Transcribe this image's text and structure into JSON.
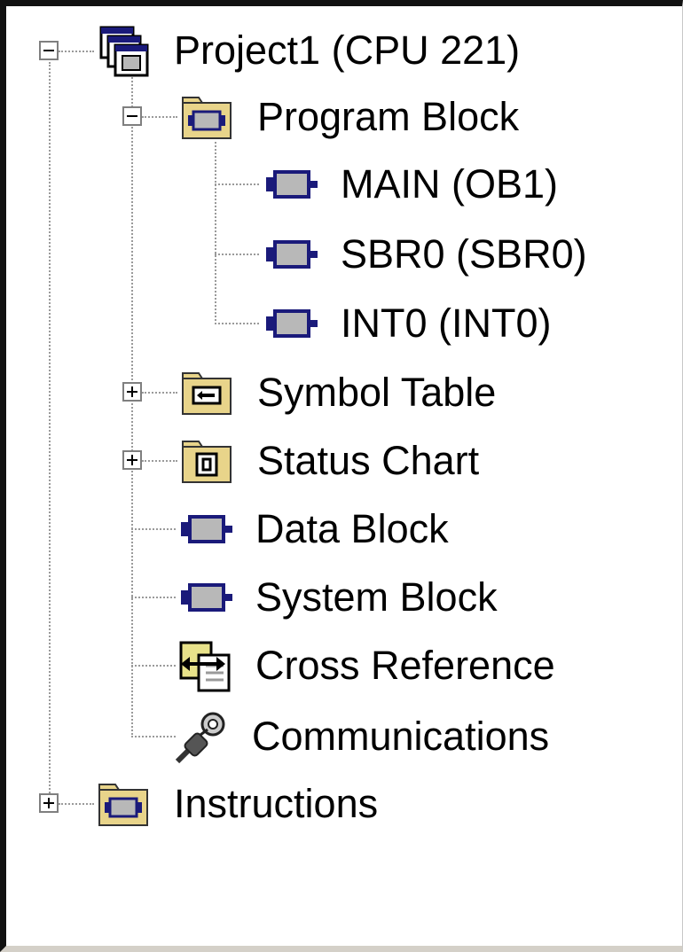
{
  "tree": {
    "root": {
      "label": "Project1 (CPU 221)",
      "icon": "project-icon",
      "expanded": true
    },
    "program_block": {
      "label": "Program Block",
      "icon": "folder-block-icon",
      "expanded": true,
      "children": [
        {
          "label": "MAIN (OB1)",
          "icon": "block-icon"
        },
        {
          "label": "SBR0 (SBR0)",
          "icon": "block-icon"
        },
        {
          "label": "INT0 (INT0)",
          "icon": "block-icon"
        }
      ]
    },
    "symbol_table": {
      "label": "Symbol Table",
      "icon": "folder-symbol-icon",
      "expanded": false
    },
    "status_chart": {
      "label": "Status Chart",
      "icon": "folder-status-icon",
      "expanded": false
    },
    "data_block": {
      "label": "Data Block",
      "icon": "block-icon"
    },
    "system_block": {
      "label": "System Block",
      "icon": "block-icon"
    },
    "cross_reference": {
      "label": "Cross Reference",
      "icon": "cross-reference-icon"
    },
    "communications": {
      "label": "Communications",
      "icon": "communications-icon"
    },
    "instructions": {
      "label": "Instructions",
      "icon": "folder-block-icon",
      "expanded": false
    }
  },
  "colors": {
    "block_fill": "#b8b8b8",
    "block_outline": "#1a1a7a",
    "folder_fill": "#e8d48a",
    "tree_line": "#9a9a9a"
  }
}
